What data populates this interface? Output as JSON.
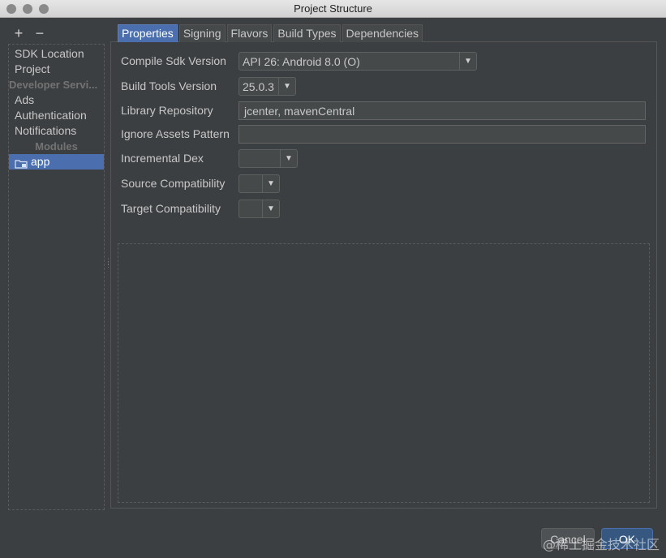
{
  "window": {
    "title": "Project Structure"
  },
  "toolbar": {
    "add": "+",
    "remove": "−"
  },
  "sidebar": {
    "items": [
      {
        "label": "SDK Location",
        "type": "item"
      },
      {
        "label": "Project",
        "type": "item"
      },
      {
        "label": "Developer Servi...",
        "type": "header"
      },
      {
        "label": "Ads",
        "type": "item"
      },
      {
        "label": "Authentication",
        "type": "item"
      },
      {
        "label": "Notifications",
        "type": "item"
      },
      {
        "label": "Modules",
        "type": "header"
      },
      {
        "label": "app",
        "type": "selected",
        "icon": "module-folder-icon"
      }
    ]
  },
  "tabs": [
    {
      "label": "Properties",
      "active": true
    },
    {
      "label": "Signing",
      "active": false
    },
    {
      "label": "Flavors",
      "active": false
    },
    {
      "label": "Build Types",
      "active": false
    },
    {
      "label": "Dependencies",
      "active": false
    }
  ],
  "properties": {
    "compile_sdk": {
      "label": "Compile Sdk Version",
      "value": "API 26: Android 8.0 (O)"
    },
    "build_tools": {
      "label": "Build Tools Version",
      "value": "25.0.3"
    },
    "library_repo": {
      "label": "Library Repository",
      "value": "jcenter, mavenCentral"
    },
    "ignore_assets": {
      "label": "Ignore Assets Pattern",
      "value": ""
    },
    "incremental_dex": {
      "label": "Incremental Dex",
      "value": ""
    },
    "source_compat": {
      "label": "Source Compatibility",
      "value": ""
    },
    "target_compat": {
      "label": "Target Compatibility",
      "value": ""
    }
  },
  "buttons": {
    "cancel": "Cancel",
    "ok": "OK"
  },
  "watermark": "@稀土掘金技术社区",
  "colors": {
    "accent": "#4b6eaf",
    "background": "#3c3f41"
  }
}
